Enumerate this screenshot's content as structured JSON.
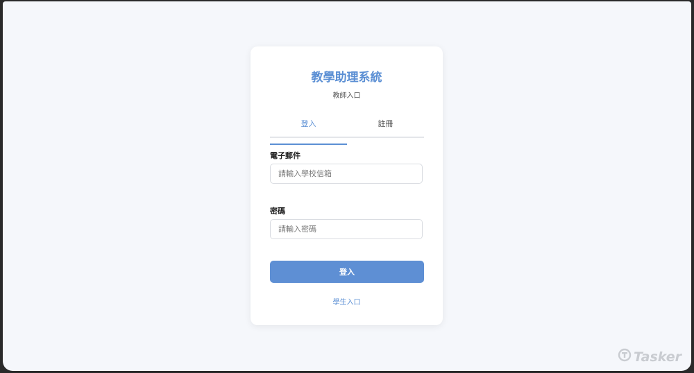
{
  "app": {
    "title": "教學助理系統",
    "subtitle": "教師入口"
  },
  "tabs": [
    {
      "label": "登入",
      "active": true
    },
    {
      "label": "註冊",
      "active": false
    }
  ],
  "form": {
    "email": {
      "label": "電子郵件",
      "placeholder": "請輸入學校信箱",
      "value": ""
    },
    "password": {
      "label": "密碼",
      "placeholder": "請輸入密碼",
      "value": ""
    },
    "submit_label": "登入"
  },
  "links": {
    "student_portal": "學生入口"
  },
  "watermark": {
    "text": "Tasker",
    "icon": "tasker-logo-icon"
  },
  "colors": {
    "accent": "#5b8fd4",
    "button": "#5e8fd4",
    "background": "#f5f7fb"
  }
}
